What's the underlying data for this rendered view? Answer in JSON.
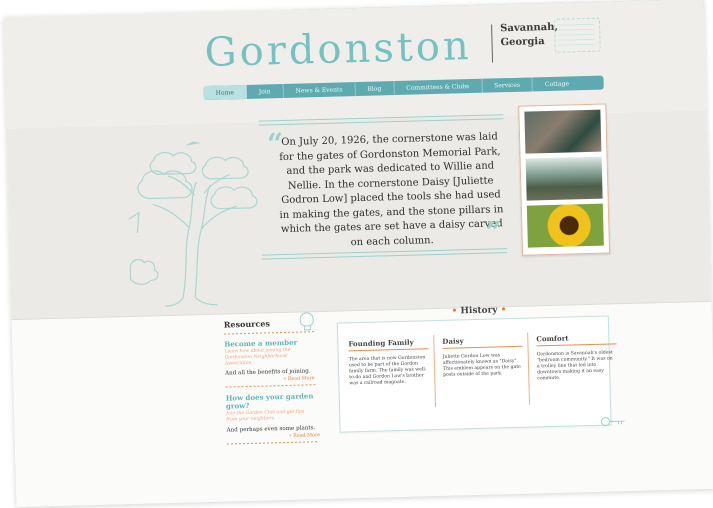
{
  "header": {
    "logo": "Gordonston",
    "city_line1": "Savannah,",
    "city_line2": "Georgia"
  },
  "nav": {
    "items": [
      {
        "label": "Home",
        "active": true
      },
      {
        "label": "Join",
        "active": false
      },
      {
        "label": "News & Events",
        "active": false
      },
      {
        "label": "Blog",
        "active": false
      },
      {
        "label": "Committees & Clubs",
        "active": false
      },
      {
        "label": "Services",
        "active": false
      },
      {
        "label": "Cottage",
        "active": false
      }
    ]
  },
  "hero": {
    "quote": "On July 20, 1926, the cornerstone was laid for the gates of Gordonston Memorial Park, and the park was dedicated to Willie and Nellie. In the cornerstone Daisy [Juliette Godron Low] placed the tools she had used in making the gates, and the stone pillars in which the gates are set have a daisy carved on each column."
  },
  "resources": {
    "title": "Resources",
    "items": [
      {
        "heading": "Become a member",
        "subtitle": "Learn how about joining the Gordonston Neighborhood Association",
        "body": "And all the benefits of joining.",
        "read_more": "» Read More"
      },
      {
        "heading": "How does your garden grow?",
        "subtitle": "Join the Garden Club and get tips from your neighbors",
        "body": "And perhaps even some plants.",
        "read_more": "» Read More"
      }
    ]
  },
  "history": {
    "title": "History",
    "columns": [
      {
        "heading": "Founding Family",
        "body": "The area that is now Gordonston used to be part of the Gordon family farm. The family was well-to-do and Gordon Low's brother was a railroad magnate."
      },
      {
        "heading": "Daisy",
        "body": "Juliette Gordon Low was affectionately known as \"Daisy\". This emblem appears on the gate posts outside of the park."
      },
      {
        "heading": "Comfort",
        "body": "Gordonston is Savannah's oldest \"bedroom community.\" It was on a trolley line that led into downtown making it an easy commute."
      }
    ]
  },
  "colors": {
    "teal": "#76c2c3",
    "nav": "#5eaab0",
    "orange": "#f07a3a"
  }
}
